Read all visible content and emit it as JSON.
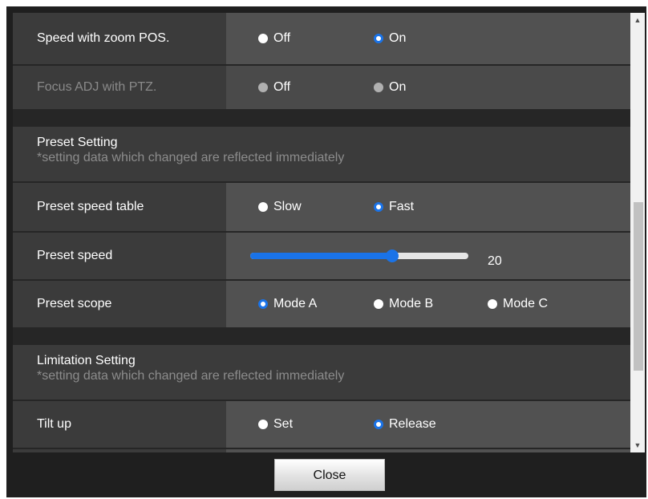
{
  "rows": {
    "speed_zoom_pos": {
      "label": "Speed with zoom POS.",
      "options": [
        "Off",
        "On"
      ],
      "selected": "On"
    },
    "focus_adj_ptz": {
      "label": "Focus ADJ with PTZ.",
      "options": [
        "Off",
        "On"
      ],
      "disabled": true
    },
    "preset_speed_table": {
      "label": "Preset speed table",
      "options": [
        "Slow",
        "Fast"
      ],
      "selected": "Fast"
    },
    "preset_speed": {
      "label": "Preset speed",
      "value": "20",
      "fill_fraction": 0.65
    },
    "preset_scope": {
      "label": "Preset scope",
      "options": [
        "Mode A",
        "Mode B",
        "Mode C"
      ],
      "selected": "Mode A"
    },
    "tilt_up": {
      "label": "Tilt up",
      "options": [
        "Set",
        "Release"
      ],
      "selected": "Release"
    }
  },
  "sections": {
    "preset": {
      "title": "Preset Setting",
      "note": "*setting data which changed are reflected immediately"
    },
    "limitation": {
      "title": "Limitation Setting",
      "note": "*setting data which changed are reflected immediately"
    }
  },
  "scrollbar": {
    "up_icon": "triangle-up-icon",
    "down_icon": "triangle-down-icon"
  },
  "footer": {
    "close_label": "Close"
  },
  "colors": {
    "accent": "#1a73e8",
    "label_bg": "#3b3b3b",
    "control_bg": "#515151",
    "disabled_text": "#8a8a8a"
  }
}
